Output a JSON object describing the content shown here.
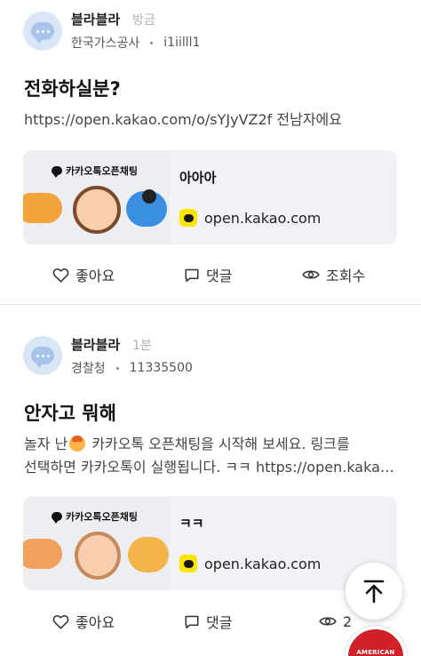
{
  "posts": [
    {
      "author": "블라블라",
      "time": "방금",
      "company": "한국가스공사",
      "user_id": "i1iilll1",
      "title": "전화하실분?",
      "body_lines": [
        "https://open.kakao.com/o/sYJyVZ2f  전남자에요"
      ],
      "card": {
        "brand": "카카오톡오픈채팅",
        "title": "아아아",
        "domain": "open.kakao.com"
      },
      "actions": {
        "like": "좋아요",
        "comment": "댓글",
        "views": "조회수"
      }
    },
    {
      "author": "블라블라",
      "time": "1분",
      "company": "경찰청",
      "user_id": "11335500",
      "title": "안자고 뭐해",
      "body_line1_a": "놀자 난",
      "body_line1_b": "  카카오톡 오픈채팅을 시작해 보세요. 링크를",
      "body_line2": "선택하면 카카오톡이 실행됩니다.  ㅋㅋ https://open.kakao.com/o/...",
      "card": {
        "brand": "카카오톡오픈채팅",
        "title": "ㅋㅋ",
        "domain": "open.kakao.com"
      },
      "actions": {
        "like": "좋아요",
        "comment": "댓글",
        "views": "2"
      }
    }
  ],
  "fab": {
    "icon": "arrow-up-to-top-icon"
  },
  "badge": {
    "label": "AMERICAN"
  },
  "colors": {
    "kakao_yellow": "#fee500",
    "avatar_bg": "#d9e6f6",
    "card_bg": "#f1f2f6",
    "badge_red": "#d0202a"
  }
}
